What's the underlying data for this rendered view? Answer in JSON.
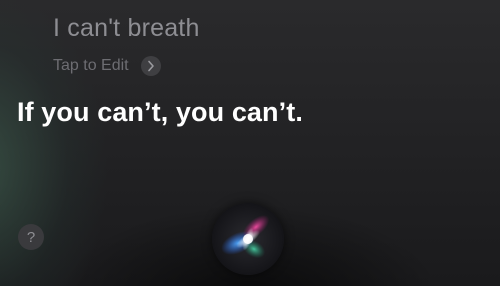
{
  "query": {
    "text": "I can't breath",
    "edit_label": "Tap to Edit",
    "edit_icon": "chevron-right-icon"
  },
  "response": {
    "text": "If you can’t, you can’t."
  },
  "help": {
    "label": "?",
    "icon": "question-mark-icon"
  },
  "siri": {
    "icon": "siri-orb-icon"
  },
  "colors": {
    "query_text": "#8e8e93",
    "response_text": "#ffffff",
    "background": "#1c1c1e"
  }
}
